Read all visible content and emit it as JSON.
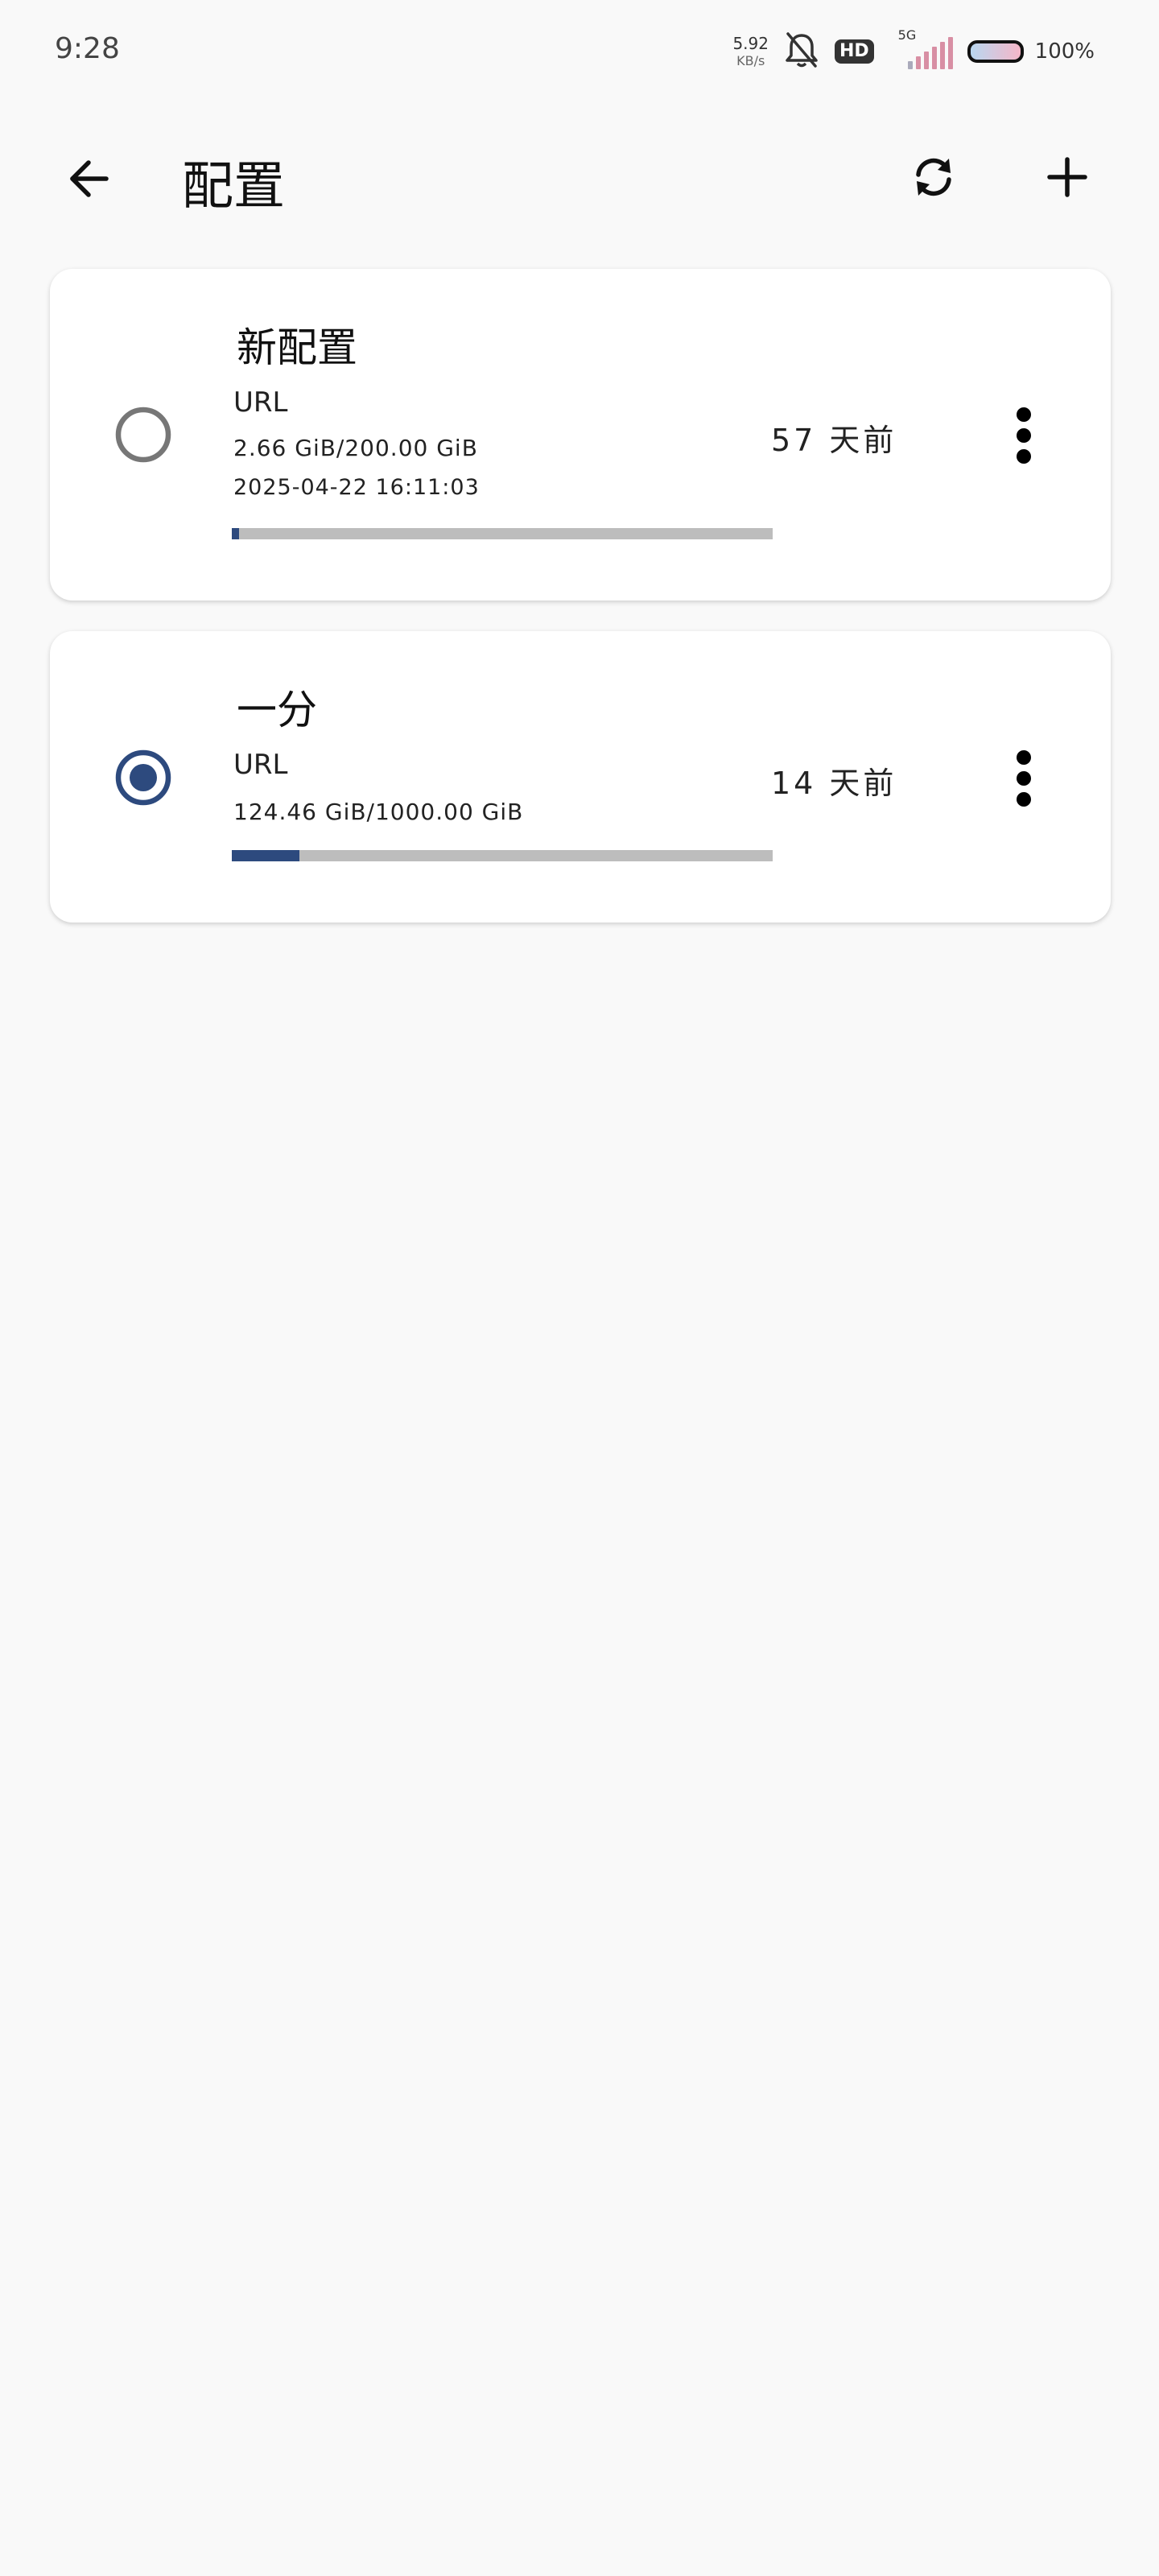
{
  "status_bar": {
    "time": "9:28",
    "net_speed_value": "5.92",
    "net_speed_unit": "KB/s",
    "hd_label": "HD",
    "network_label": "5G",
    "battery_percent": "100%",
    "icons": [
      "bell-off-icon",
      "hd-icon",
      "signal-icon",
      "battery-icon"
    ]
  },
  "app_bar": {
    "title": "配置",
    "icons": [
      "back-arrow-icon",
      "refresh-icon",
      "add-icon"
    ]
  },
  "profiles": [
    {
      "name": "新配置",
      "type": "URL",
      "usage": "2.66 GiB/200.00 GiB",
      "expire": "2025-04-22 16:11:03",
      "updated": "57 天前",
      "selected": false,
      "usage_fraction": 0.0133
    },
    {
      "name": "一分",
      "type": "URL",
      "usage": "124.46 GiB/1000.00 GiB",
      "updated": "14 天前",
      "selected": true,
      "usage_fraction": 0.1245
    }
  ],
  "colors": {
    "accent": "#2d4a7e",
    "track": "#bdbdbd",
    "radio_unselected": "#777777",
    "background": "#f9f9f9",
    "card": "#ffffff"
  }
}
